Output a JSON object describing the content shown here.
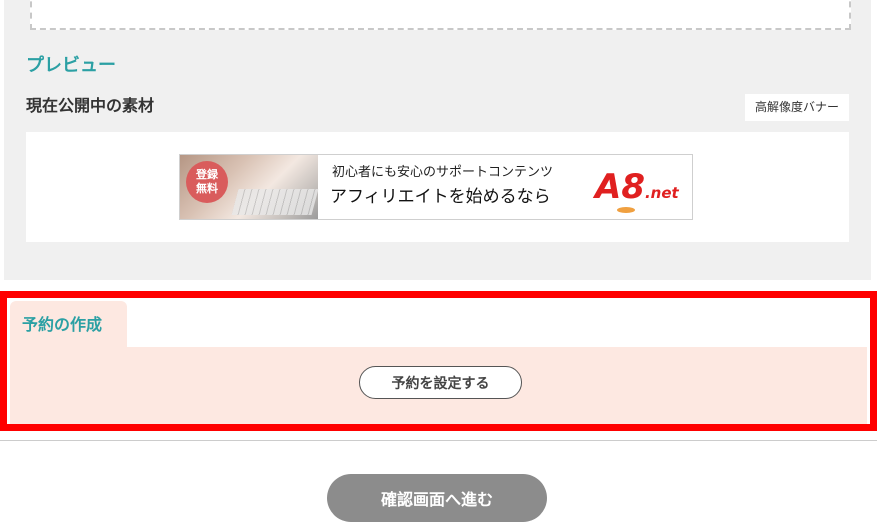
{
  "preview": {
    "heading": "プレビュー",
    "material_title": "現在公開中の素材",
    "hd_banner_label": "高解像度バナー"
  },
  "banner": {
    "badge_line1": "登録",
    "badge_line2": "無料",
    "tagline": "初心者にも安心のサポートコンテンツ",
    "headline": "アフィリエイトを始めるなら",
    "logo_main": "A8",
    "logo_suffix": ".net",
    "brand_color": "#e02020"
  },
  "reservation": {
    "tab_label": "予約の作成",
    "set_button_label": "予約を設定する",
    "highlight_color": "#ff0000",
    "panel_color": "#fde8e1"
  },
  "footer": {
    "confirm_button_label": "確認画面へ進む"
  }
}
